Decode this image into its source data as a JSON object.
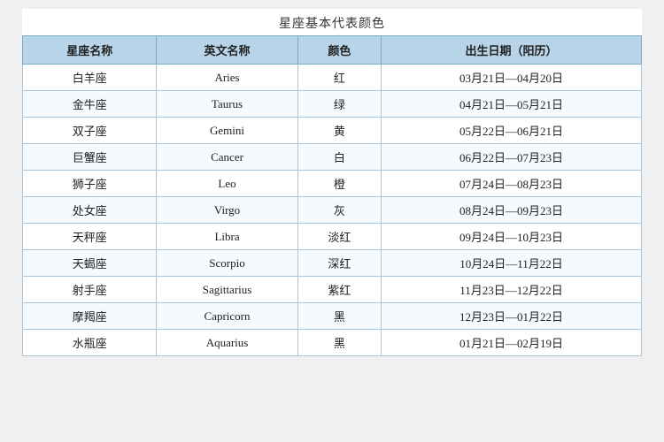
{
  "title": "星座基本代表颜色",
  "headers": {
    "col1": "星座名称",
    "col2": "英文名称",
    "col3": "颜色",
    "col4": "出生日期（阳历）"
  },
  "rows": [
    {
      "zh": "白羊座",
      "en": "Aries",
      "color": "红",
      "date": "03月21日—04月20日"
    },
    {
      "zh": "金牛座",
      "en": "Taurus",
      "color": "绿",
      "date": "04月21日—05月21日"
    },
    {
      "zh": "双子座",
      "en": "Gemini",
      "color": "黄",
      "date": "05月22日—06月21日"
    },
    {
      "zh": "巨蟹座",
      "en": "Cancer",
      "color": "白",
      "date": "06月22日—07月23日"
    },
    {
      "zh": "狮子座",
      "en": "Leo",
      "color": "橙",
      "date": "07月24日—08月23日"
    },
    {
      "zh": "处女座",
      "en": "Virgo",
      "color": "灰",
      "date": "08月24日—09月23日"
    },
    {
      "zh": "天秤座",
      "en": "Libra",
      "color": "淡红",
      "date": "09月24日—10月23日"
    },
    {
      "zh": "天蝎座",
      "en": "Scorpio",
      "color": "深红",
      "date": "10月24日—11月22日"
    },
    {
      "zh": "射手座",
      "en": "Sagittarius",
      "color": "紫红",
      "date": "11月23日—12月22日"
    },
    {
      "zh": "摩羯座",
      "en": "Capricorn",
      "color": "黑",
      "date": "12月23日—01月22日"
    },
    {
      "zh": "水瓶座",
      "en": "Aquarius",
      "color": "黑",
      "date": "01月21日—02月19日"
    }
  ]
}
